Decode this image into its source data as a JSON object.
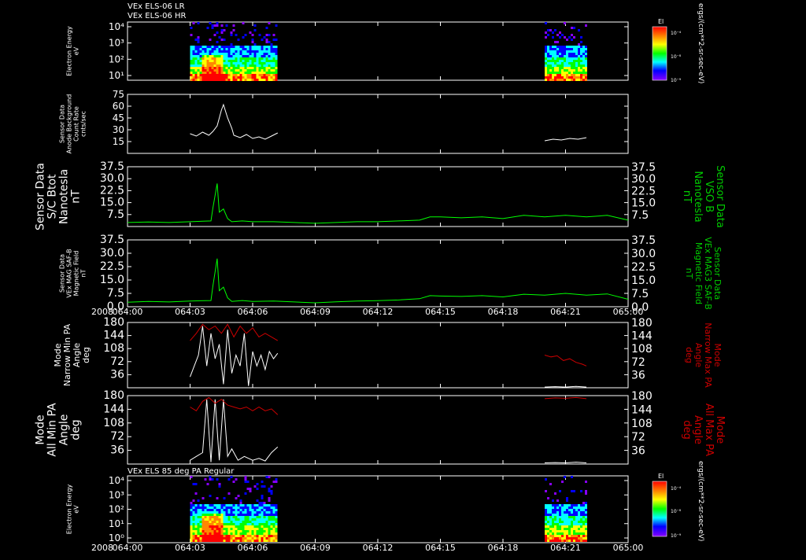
{
  "panel_titles": {
    "top_line1": "VEx ELS-06 LR",
    "top_line2": "VEx ELS-06 HR",
    "bottom": "VEx ELS 85 deg PA Regular"
  },
  "x_axis": {
    "year": "2008",
    "ticks": [
      "064:00",
      "064:03",
      "064:06",
      "064:09",
      "064:12",
      "064:15",
      "064:18",
      "064:21",
      "065:00"
    ]
  },
  "colorbar": {
    "label": "El",
    "ticks": [
      "10⁻⁴",
      "10⁻⁸",
      "10⁻⁹"
    ],
    "units": "ergs/(cm**2-sr-sec-eV)",
    "colors": [
      "#ff0000",
      "#ff8800",
      "#ffff00",
      "#00ff00",
      "#00ffff",
      "#0000ff",
      "#8800ff"
    ]
  },
  "colors": {
    "white_trace": "#ffffff",
    "green_trace": "#00ff00",
    "red_trace": "#cc0000",
    "axes": "#ffffff"
  },
  "chart_data": [
    {
      "type": "heatmap",
      "ylabel": [
        "Electron Energy",
        "eV"
      ],
      "yticks": [
        "10⁴",
        "10³",
        "10²",
        "10¹"
      ],
      "data_intervals": [
        [
          "064:03",
          "064:07.2"
        ],
        [
          "064:20",
          "064:22"
        ]
      ]
    },
    {
      "type": "line",
      "ylabel": [
        "Sensor Data",
        "Anode Background",
        "Count Rate",
        "cnts/sec"
      ],
      "yticks": [
        "75",
        "60",
        "45",
        "30",
        "15"
      ],
      "ylim": [
        0,
        75
      ],
      "series": [
        {
          "color": "white",
          "x": [
            3.0,
            3.3,
            3.6,
            3.9,
            4.1,
            4.3,
            4.5,
            4.6,
            4.8,
            5.0,
            5.1,
            5.4,
            5.7,
            6.0,
            6.3,
            6.6,
            6.9,
            7.2
          ],
          "y": [
            25,
            22,
            27,
            23,
            28,
            35,
            55,
            62,
            45,
            32,
            23,
            20,
            24,
            19,
            21,
            18,
            22,
            26
          ]
        },
        {
          "color": "white",
          "x": [
            20.0,
            20.4,
            20.8,
            21.2,
            21.6,
            22.0
          ],
          "y": [
            16,
            18,
            17,
            19,
            18,
            20
          ]
        }
      ]
    },
    {
      "type": "line",
      "ylabel_left": [
        "Sensor Data",
        "S/C Btot",
        "Nanotesla",
        "nT"
      ],
      "ylabel_right": [
        "Sensor Data",
        "VSO B",
        "Nanotesla",
        "nT"
      ],
      "yticks": [
        "37.5",
        "30.0",
        "22.5",
        "15.0",
        "7.5"
      ],
      "ylim": [
        0,
        37.5
      ],
      "series": [
        {
          "color": "green",
          "x": [
            0,
            1,
            2,
            3,
            4,
            4.1,
            4.3,
            4.4,
            4.6,
            4.8,
            5,
            5.5,
            6,
            7,
            8,
            9,
            10,
            11,
            12,
            13,
            14,
            14.5,
            15,
            16,
            17,
            18,
            19,
            20,
            21,
            22,
            23,
            24
          ],
          "y": [
            2.5,
            2.8,
            2.5,
            3,
            3.5,
            12,
            27,
            9,
            11,
            5,
            3,
            3.5,
            3,
            3,
            2.5,
            2,
            2.5,
            3,
            3,
            3.5,
            4,
            6,
            6,
            5.5,
            6,
            5,
            7,
            6,
            7,
            6,
            7,
            4
          ]
        }
      ]
    },
    {
      "type": "line",
      "ylabel_left": [
        "Sensor Data",
        "VEx MAG SAF-B",
        "Magnetic Field",
        "nT"
      ],
      "ylabel_right": [
        "Sensor Data",
        "VEx MAG3 SAF-B",
        "Magnetic Field",
        "nT"
      ],
      "yticks": [
        "37.5",
        "30.0",
        "22.5",
        "15.0",
        "7.5",
        "0.0"
      ],
      "ylim": [
        0,
        37.5
      ],
      "series": [
        {
          "color": "green",
          "x": [
            0,
            1,
            2,
            3,
            4,
            4.1,
            4.3,
            4.4,
            4.6,
            4.8,
            5,
            5.5,
            6,
            7,
            8,
            9,
            10,
            11,
            12,
            13,
            14,
            14.5,
            15,
            16,
            17,
            18,
            19,
            20,
            21,
            22,
            23,
            24
          ],
          "y": [
            2.5,
            3,
            2.7,
            3.2,
            3.5,
            12,
            27,
            9,
            11,
            5,
            3,
            3.5,
            3,
            3.2,
            2.7,
            2.2,
            2.8,
            3.2,
            3.4,
            3.8,
            4.5,
            6.2,
            6,
            5.8,
            6.2,
            5.5,
            7,
            6.5,
            7.5,
            6.5,
            7.2,
            4.2
          ]
        }
      ]
    },
    {
      "type": "line",
      "ylabel_left": [
        "Mode",
        "Narrow Min PA",
        "Angle",
        "deg"
      ],
      "ylabel_right": [
        "Mode",
        "Narrow Max PA",
        "Angle",
        "deg"
      ],
      "yticks": [
        "180",
        "144",
        "108",
        "72",
        "36"
      ],
      "ylim": [
        0,
        180
      ],
      "series": [
        {
          "color": "white",
          "x": [
            3.0,
            3.2,
            3.4,
            3.6,
            3.8,
            4.0,
            4.2,
            4.4,
            4.6,
            4.8,
            5.0,
            5.2,
            5.4,
            5.6,
            5.8,
            6.0,
            6.2,
            6.4,
            6.6,
            6.8,
            7.0,
            7.2
          ],
          "y": [
            30,
            60,
            90,
            170,
            60,
            150,
            80,
            120,
            10,
            160,
            40,
            90,
            60,
            150,
            5,
            100,
            60,
            90,
            50,
            100,
            80,
            95
          ]
        },
        {
          "color": "red",
          "x": [
            3.0,
            3.3,
            3.6,
            3.9,
            4.2,
            4.5,
            4.8,
            5.1,
            5.4,
            5.7,
            6.0,
            6.3,
            6.6,
            6.9,
            7.2
          ],
          "y": [
            130,
            150,
            175,
            160,
            170,
            150,
            175,
            140,
            170,
            150,
            165,
            140,
            150,
            140,
            130
          ]
        },
        {
          "color": "white",
          "x": [
            20.0,
            20.5,
            21.0,
            21.5,
            22.0
          ],
          "y": [
            2,
            3,
            2,
            4,
            2
          ]
        },
        {
          "color": "red",
          "x": [
            20.0,
            20.3,
            20.6,
            20.9,
            21.2,
            21.5,
            21.8,
            22.0
          ],
          "y": [
            90,
            85,
            88,
            75,
            80,
            70,
            65,
            60
          ]
        }
      ]
    },
    {
      "type": "line",
      "ylabel_left": [
        "Mode",
        "All Min PA",
        "Angle",
        "deg"
      ],
      "ylabel_right": [
        "Mode",
        "All Max PA",
        "Angle",
        "deg"
      ],
      "yticks": [
        "180",
        "144",
        "108",
        "72",
        "36"
      ],
      "ylim": [
        0,
        180
      ],
      "series": [
        {
          "color": "white",
          "x": [
            3.0,
            3.3,
            3.6,
            3.8,
            4.0,
            4.2,
            4.4,
            4.6,
            4.8,
            5.0,
            5.3,
            5.6,
            6.0,
            6.3,
            6.6,
            6.9,
            7.2
          ],
          "y": [
            10,
            20,
            30,
            170,
            5,
            170,
            10,
            170,
            20,
            40,
            10,
            20,
            10,
            15,
            8,
            30,
            45
          ]
        },
        {
          "color": "red",
          "x": [
            3.0,
            3.3,
            3.6,
            3.9,
            4.2,
            4.5,
            4.8,
            5.1,
            5.4,
            5.7,
            6.0,
            6.3,
            6.6,
            6.9,
            7.2
          ],
          "y": [
            150,
            140,
            165,
            175,
            160,
            170,
            155,
            150,
            145,
            150,
            140,
            150,
            140,
            145,
            130
          ]
        },
        {
          "color": "white",
          "x": [
            20.0,
            20.5,
            21.0,
            21.5,
            22.0
          ],
          "y": [
            3,
            4,
            3,
            5,
            3
          ]
        },
        {
          "color": "red",
          "x": [
            20.0,
            20.5,
            21.0,
            21.5,
            22.0
          ],
          "y": [
            172,
            174,
            173,
            175,
            172
          ]
        }
      ]
    },
    {
      "type": "heatmap",
      "ylabel": [
        "Electron Energy",
        "eV"
      ],
      "yticks": [
        "10⁴",
        "10³",
        "10²",
        "10¹",
        "10⁰"
      ],
      "data_intervals": [
        [
          "064:03",
          "064:07.2"
        ],
        [
          "064:20",
          "064:22"
        ]
      ]
    }
  ]
}
